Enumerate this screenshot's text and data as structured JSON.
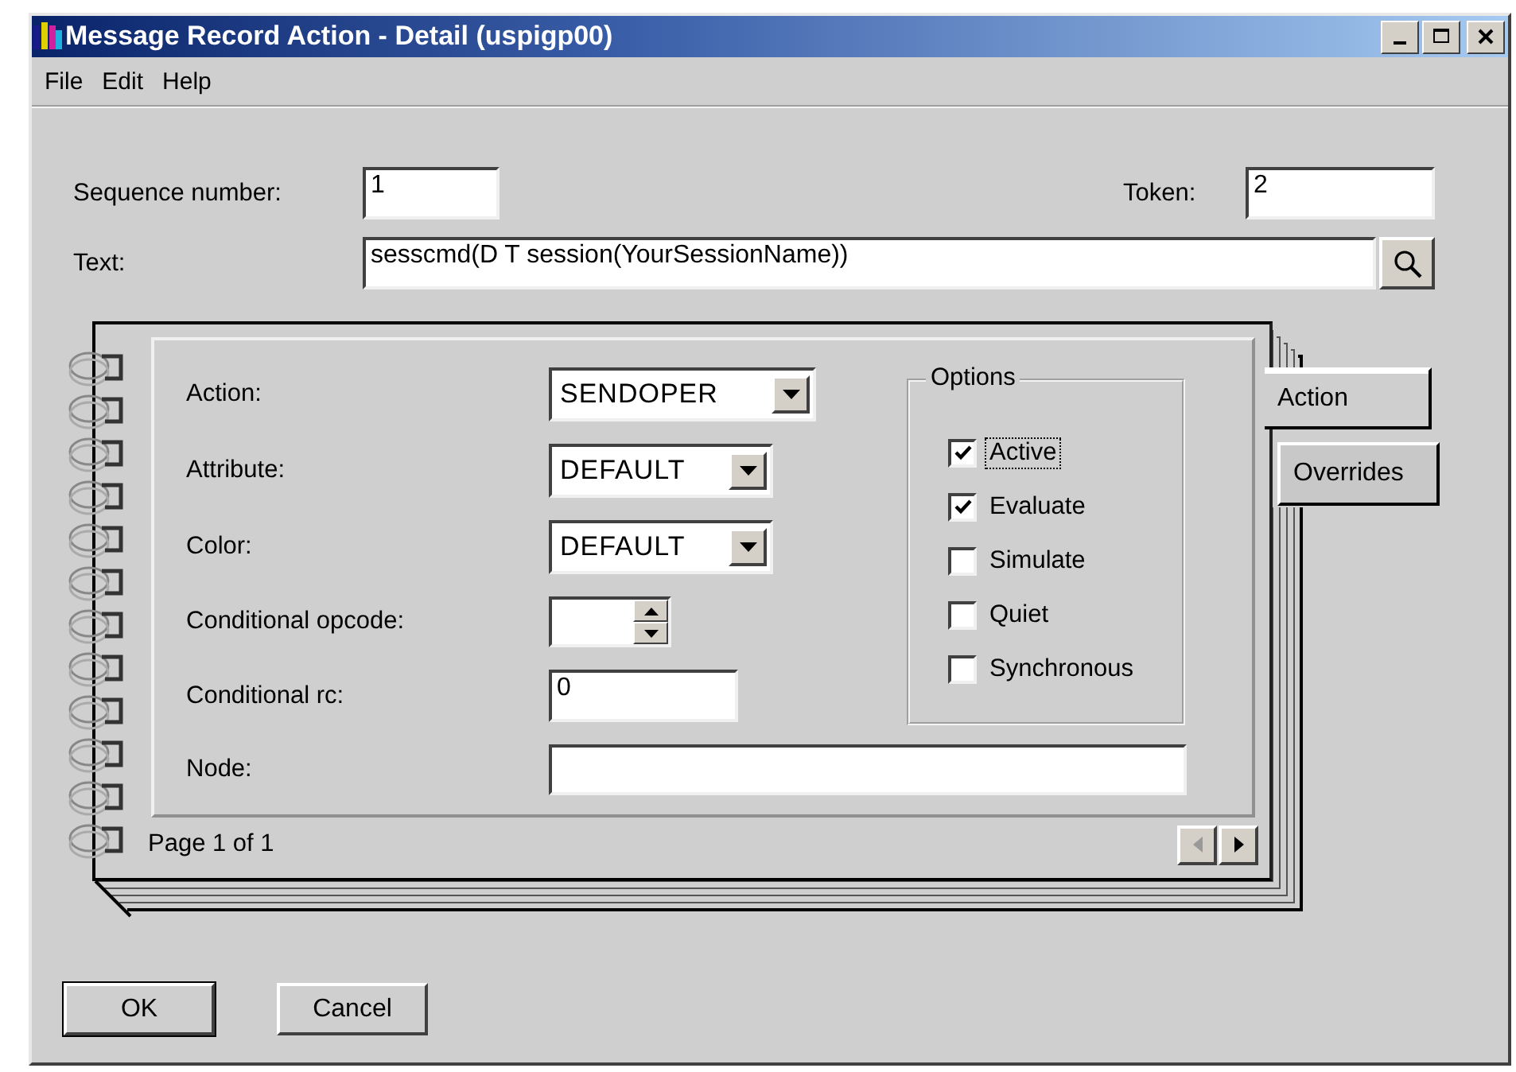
{
  "window": {
    "title": "Message Record Action - Detail (uspigp00)"
  },
  "menu": [
    "File",
    "Edit",
    "Help"
  ],
  "sequence_number": {
    "label": "Sequence number:",
    "value": "1"
  },
  "token": {
    "label": "Token:",
    "value": "2"
  },
  "text": {
    "label": "Text:",
    "value": "sesscmd(D T session(YourSessionName))"
  },
  "notebook": {
    "tabs": [
      {
        "label": "Action",
        "selected": true
      },
      {
        "label": "Overrides",
        "selected": false
      }
    ],
    "fields": [
      {
        "kind": "combo",
        "label": "Action:",
        "value": "SENDOPER"
      },
      {
        "kind": "combo",
        "label": "Attribute:",
        "value": "DEFAULT"
      },
      {
        "kind": "combo",
        "label": "Color:",
        "value": "DEFAULT"
      },
      {
        "kind": "spin",
        "label": "Conditional opcode:"
      },
      {
        "kind": "text",
        "label": "Conditional rc:",
        "value": "0"
      },
      {
        "kind": "text",
        "label": "Node:"
      }
    ],
    "options": {
      "title": "Options",
      "items": [
        {
          "label": "Active",
          "checked": true,
          "focused": true
        },
        {
          "label": "Evaluate",
          "checked": true,
          "focused": false
        },
        {
          "label": "Simulate",
          "checked": false,
          "focused": false
        },
        {
          "label": "Quiet",
          "checked": false,
          "focused": false
        },
        {
          "label": "Synchronous",
          "checked": false,
          "focused": false
        }
      ]
    },
    "page_indicator": "Page 1 of 1"
  },
  "buttons": [
    {
      "label": "OK",
      "default": true
    },
    {
      "label": "Cancel",
      "default": false
    }
  ]
}
